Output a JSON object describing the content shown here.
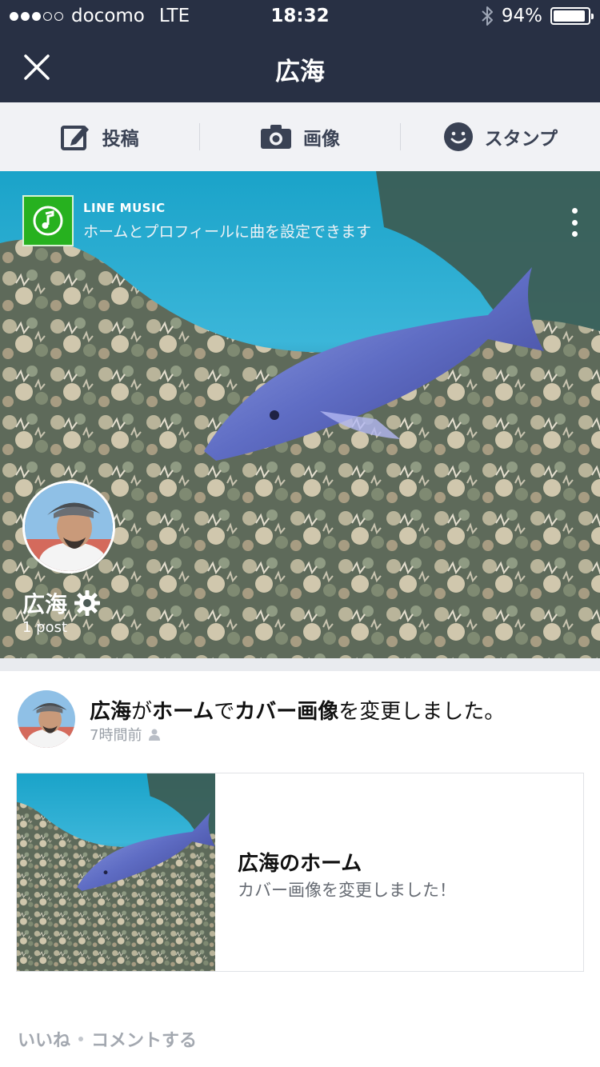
{
  "status_bar": {
    "carrier": "docomo",
    "network": "LTE",
    "time": "18:32",
    "battery": "94%",
    "battery_level": 0.94,
    "icons": [
      "signal-icon",
      "bluetooth-icon",
      "battery-icon"
    ]
  },
  "nav": {
    "title": "広海",
    "close_icon": "close-icon"
  },
  "toolbar": {
    "post_label": "投稿",
    "image_label": "画像",
    "sticker_label": "スタンプ"
  },
  "cover": {
    "music_brand": "LINE MUSIC",
    "music_desc": "ホームとプロフィールに曲を設定できます",
    "profile_name": "広海",
    "post_count": "1 post"
  },
  "feed": {
    "headline_parts": {
      "name": "広海",
      "p1": "が",
      "home": "ホーム",
      "p2": "で",
      "cover": "カバー画像",
      "p3": "を変更しました。"
    },
    "time_ago": "7時間前",
    "card_title": "広海のホーム",
    "card_sub": "カバー画像を変更しました！",
    "like_label": "いいね",
    "comment_label": "コメントする"
  },
  "colors": {
    "nav_bg": "#283044",
    "toolbar_bg": "#f1f2f5",
    "line_green": "#27b11f",
    "muted_text": "#9aa0a8"
  }
}
